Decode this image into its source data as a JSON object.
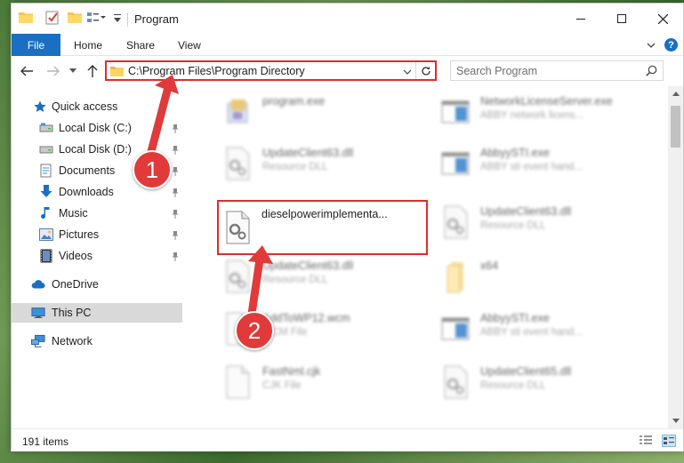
{
  "window": {
    "title": "Program"
  },
  "ribbon": {
    "file": "File",
    "home": "Home",
    "share": "Share",
    "view": "View",
    "help": "?"
  },
  "address": {
    "path": "C:\\Program Files\\Program Directory"
  },
  "search": {
    "placeholder": "Search Program"
  },
  "sidebar": {
    "items": [
      {
        "label": "Quick access",
        "icon": "star-icon"
      },
      {
        "label": "Local Disk (C:)",
        "icon": "drive-icon",
        "pinned": true
      },
      {
        "label": "Local Disk (D:)",
        "icon": "drive-icon",
        "pinned": true
      },
      {
        "label": "Documents",
        "icon": "documents-icon",
        "pinned": true
      },
      {
        "label": "Downloads",
        "icon": "download-icon",
        "pinned": true
      },
      {
        "label": "Music",
        "icon": "music-icon",
        "pinned": true
      },
      {
        "label": "Pictures",
        "icon": "pictures-icon",
        "pinned": true
      },
      {
        "label": "Videos",
        "icon": "videos-icon",
        "pinned": true
      },
      {
        "label": "OneDrive",
        "icon": "cloud-icon"
      },
      {
        "label": "This PC",
        "icon": "computer-icon",
        "selected": true
      },
      {
        "label": "Network",
        "icon": "network-icon"
      }
    ]
  },
  "files": [
    {
      "name": "program.exe",
      "type": "",
      "icon": "exe-icon"
    },
    {
      "name": "NetworkLicenseServer.exe",
      "type": "ABBY network licens...",
      "icon": "app-window-icon"
    },
    {
      "name": "UpdateClient63.dll",
      "type": "Resource DLL",
      "icon": "dll-icon"
    },
    {
      "name": "AbbyySTI.exe",
      "type": "ABBY sti event hand...",
      "icon": "app-window-icon"
    },
    {
      "name": "dieselpowerimplementa...",
      "type": "",
      "icon": "dll-icon",
      "highlighted": true
    },
    {
      "name": "UpdateClient63.dll",
      "type": "Resource DLL",
      "icon": "dll-icon"
    },
    {
      "name": "UpdateClient63.dll",
      "type": "Resource DLL",
      "icon": "dll-icon"
    },
    {
      "name": "x64",
      "type": "",
      "icon": "folder-icon"
    },
    {
      "name": "AddToWP12.wcm",
      "type": "WCM File",
      "icon": "file-icon"
    },
    {
      "name": "AbbyySTI.exe",
      "type": "ABBY sti event hand...",
      "icon": "app-window-icon"
    },
    {
      "name": "FastNml.cjk",
      "type": "CJK File",
      "icon": "file-icon"
    },
    {
      "name": "UpdateClient65.dll",
      "type": "Resource DLL",
      "icon": "dll-icon"
    }
  ],
  "status": {
    "count": "191 items"
  },
  "annotations": {
    "step1": "1",
    "step2": "2"
  },
  "colors": {
    "accent": "#1a6fc2",
    "highlight": "#e02b2b",
    "badge": "#e03a3a"
  }
}
